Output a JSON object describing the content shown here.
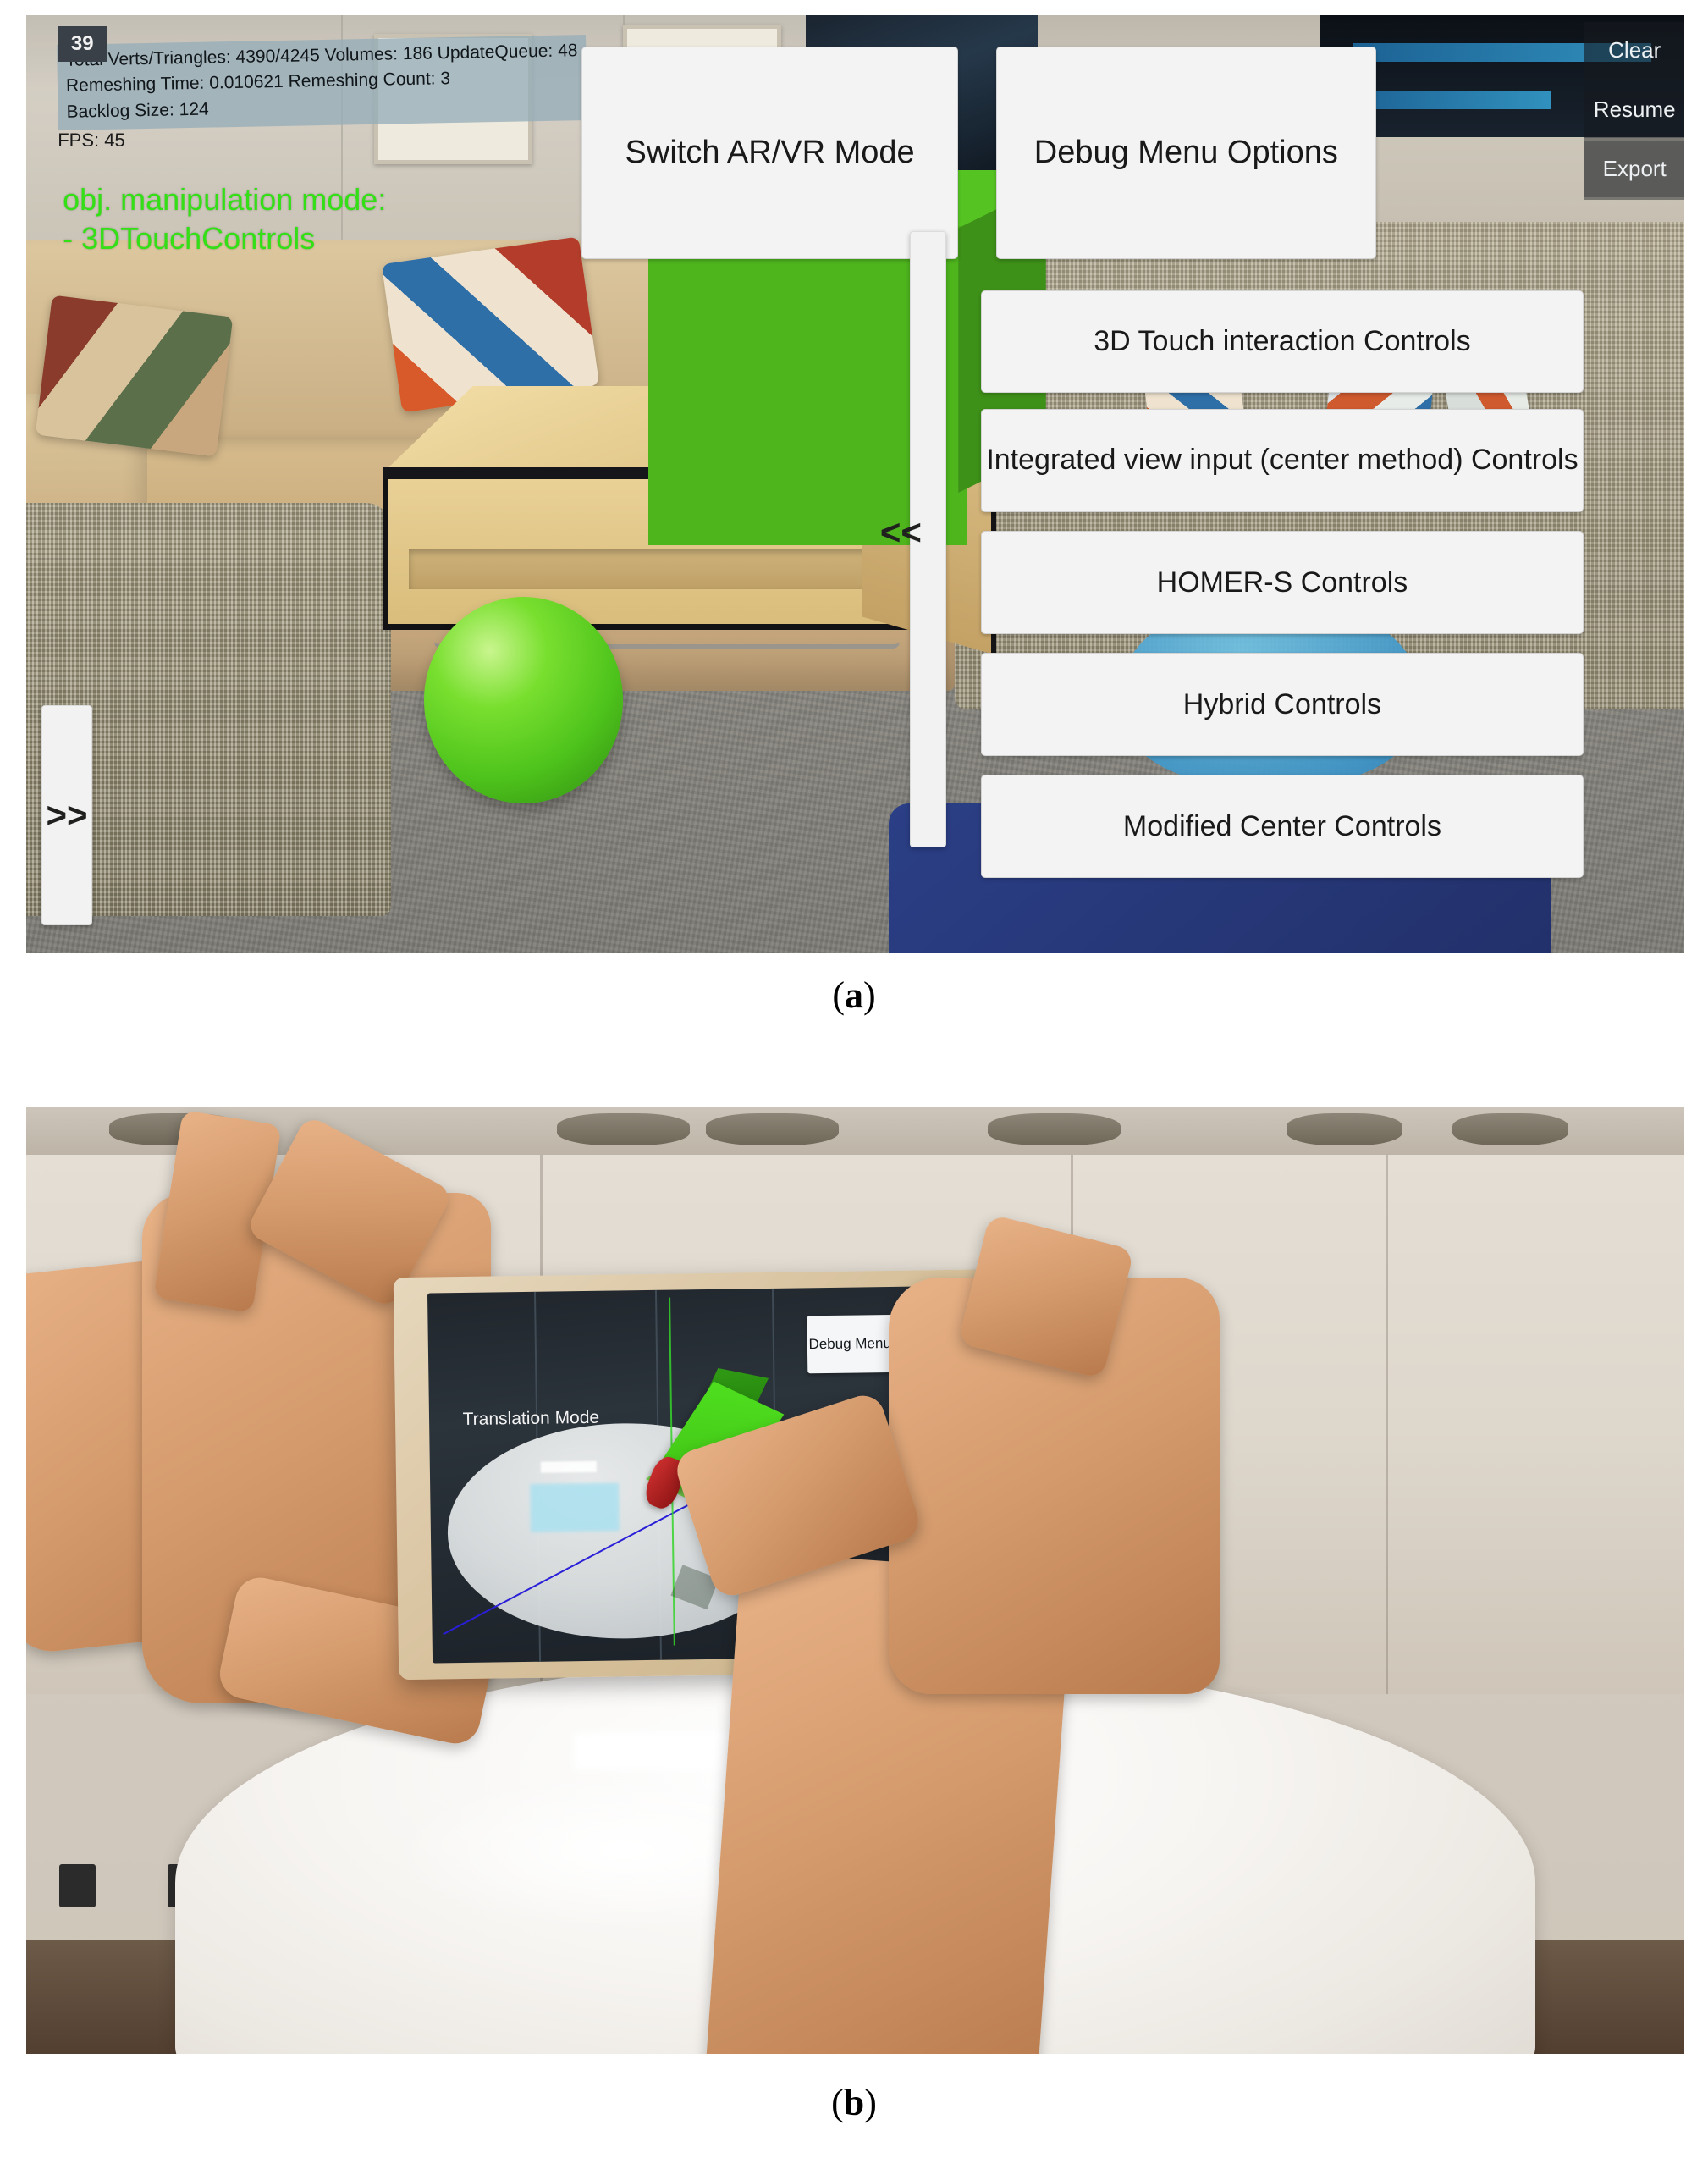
{
  "figure": {
    "caption_a": "(a)",
    "caption_b": "(b)"
  },
  "panel_a": {
    "hud": {
      "badge": "39",
      "debug_line_1": "Total Verts/Triangles: 4390/4245 Volumes: 186 UpdateQueue: 48",
      "debug_line_2": "Remeshing Time: 0.010621 Remeshing Count: 3",
      "debug_line_3": "Backlog Size: 124",
      "fps": "FPS: 45",
      "manipulation_mode": "obj. manipulation mode:\n - 3DTouchControls"
    },
    "top_buttons": [
      {
        "label": "Switch AR/VR Mode",
        "name": "switch-ar-vr-mode-button"
      },
      {
        "label": "Debug Menu Options",
        "name": "debug-menu-options-button"
      }
    ],
    "control_buttons": [
      {
        "label": "3D Touch interaction Controls",
        "name": "three-d-touch-interaction-controls-button"
      },
      {
        "label": "Integrated view input (center method) Controls",
        "name": "integrated-view-input-controls-button"
      },
      {
        "label": "HOMER-S Controls",
        "name": "homer-s-controls-button"
      },
      {
        "label": "Hybrid Controls",
        "name": "hybrid-controls-button"
      },
      {
        "label": "Modified Center Controls",
        "name": "modified-center-controls-button"
      }
    ],
    "debug_panel": {
      "clear": "Clear",
      "resume": "Resume",
      "export": "Export"
    },
    "handles": {
      "collapse": "<<",
      "expand": ">>"
    },
    "colors": {
      "ar_object_green": "#4eb51d",
      "hud_text_green": "#33e016",
      "button_background": "#f3f3f3"
    }
  },
  "panel_b": {
    "device_screen": {
      "mode_label": "Translation Mode",
      "debug_menu_button": "Debug Menu Options"
    },
    "colors": {
      "ar_cube_green": "#4fdf1f",
      "ar_cylinder_red": "#d03030",
      "axis_green": "#35d42a",
      "axis_blue": "#2a1fd8"
    }
  }
}
